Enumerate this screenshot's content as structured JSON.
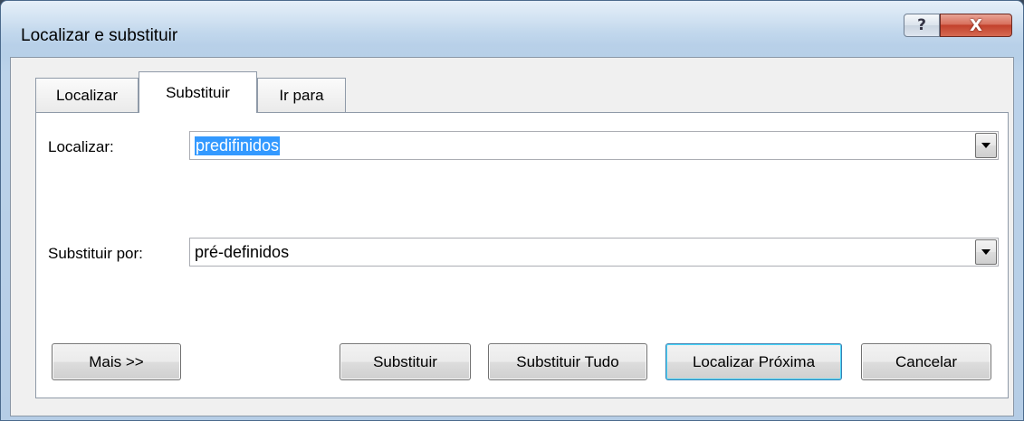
{
  "window": {
    "title": "Localizar e substituir",
    "help_glyph": "?",
    "close_glyph": "X"
  },
  "tabs": [
    {
      "label": "Localizar",
      "active": false
    },
    {
      "label": "Substituir",
      "active": true
    },
    {
      "label": "Ir para",
      "active": false
    }
  ],
  "find": {
    "label": "Localizar:",
    "value": "predifinidos"
  },
  "replace": {
    "label": "Substituir por:",
    "value": "pré-definidos"
  },
  "buttons": {
    "more": "Mais >>",
    "replace": "Substituir",
    "replace_all": "Substituir Tudo",
    "find_next": "Localizar Próxima",
    "cancel": "Cancelar"
  },
  "colors": {
    "selection": "#3399ff",
    "close_button": "#c2412c",
    "default_button_border": "#3c7fb1"
  }
}
